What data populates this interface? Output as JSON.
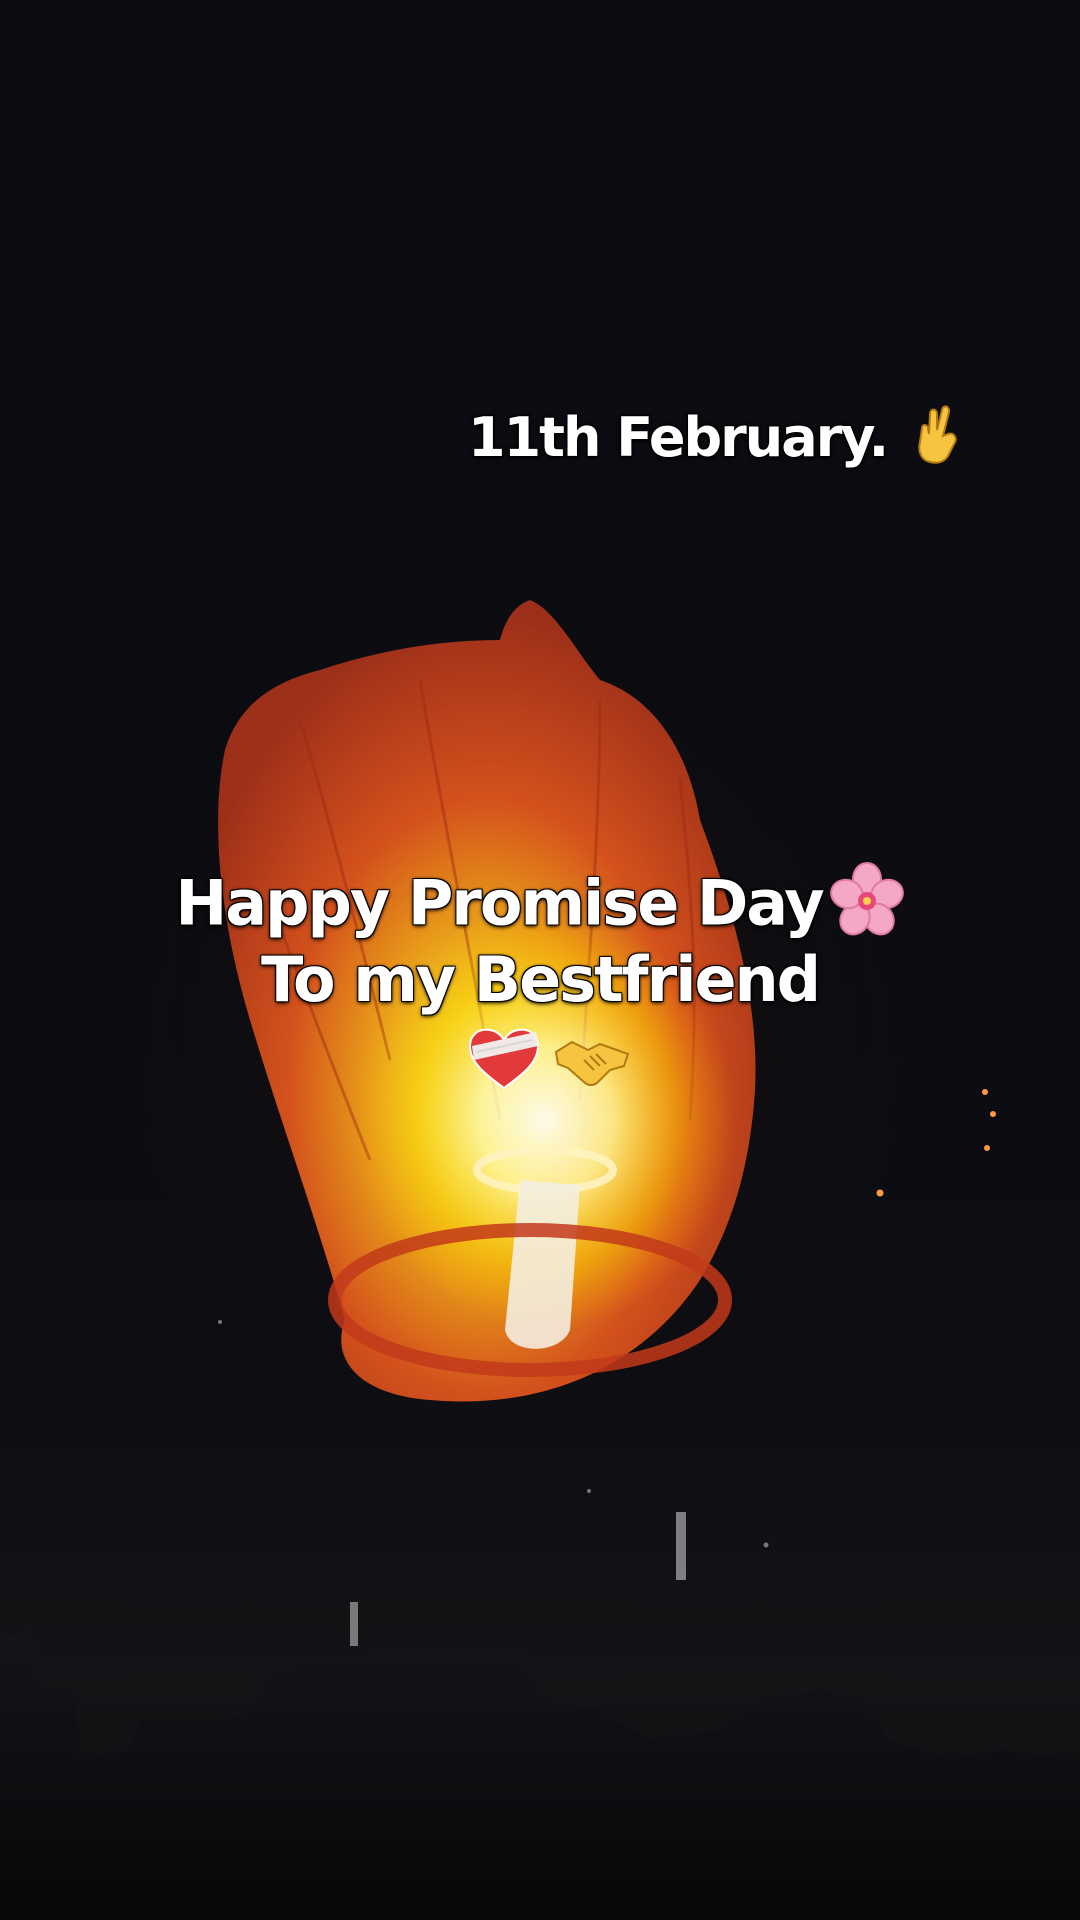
{
  "captions": {
    "date": "11th February.",
    "line1": "Happy Promise Day",
    "line2": "To my Bestfriend"
  },
  "emojis": {
    "date_icon": "crossed-fingers-icon",
    "line1_icon": "cherry-blossom-icon",
    "row_icons": [
      "mending-heart-icon",
      "handshake-icon"
    ]
  },
  "colors": {
    "sky": "#0b0c10",
    "lantern_orange": "#e0561e",
    "lantern_glow": "#ffd21a",
    "caption_text": "#ffffff"
  }
}
